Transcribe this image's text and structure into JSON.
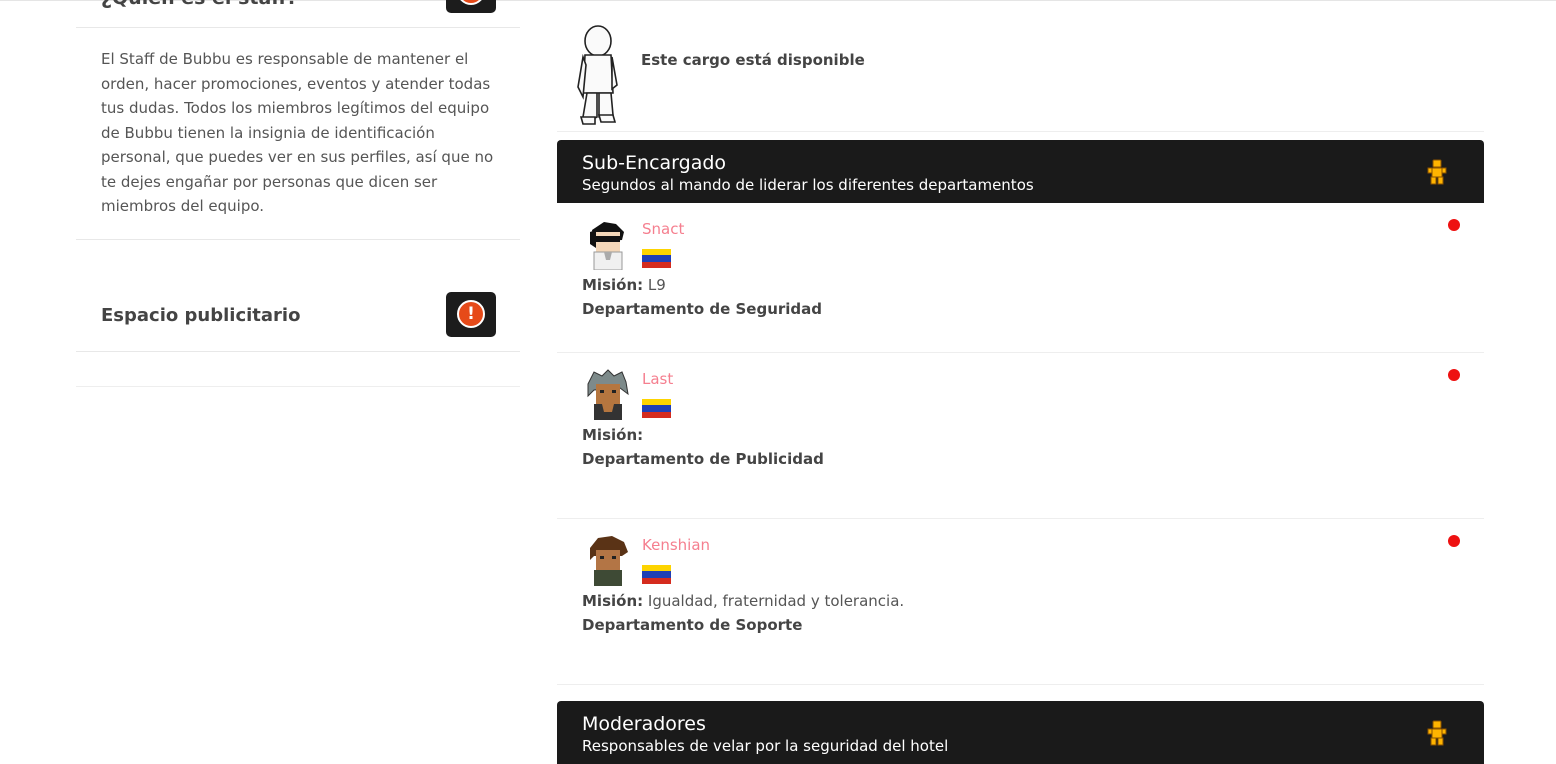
{
  "sidebar": {
    "staff_title": "¿Quién es el staff?",
    "staff_description": "El Staff de Bubbu es responsable de mantener el orden, hacer promociones, eventos y atender todas tus dudas. Todos los miembros legítimos del equipo de Bubbu tienen la insignia de identificación personal, que puedes ver en sus perfiles, así que no te dejes engañar por personas que dicen ser miembros del equipo.",
    "ad_title": "Espacio publicitario",
    "alert_icon": "exclamation-icon",
    "alert_glyph": "!"
  },
  "main": {
    "available_label": "Este cargo está disponible",
    "sections": [
      {
        "name": "Sub-Encargado",
        "subtitle": "Segundos al mando de liderar los diferentes departamentos",
        "members": [
          {
            "username": "Snact",
            "mission_label": "Misión:",
            "mission_value": "L9",
            "department": "Departamento de Seguridad",
            "status": "offline"
          },
          {
            "username": "Last",
            "mission_label": "Misión:",
            "mission_value": "",
            "department": "Departamento de Publicidad",
            "status": "offline"
          },
          {
            "username": "Kenshian",
            "mission_label": "Misión:",
            "mission_value": "Igualdad, fraternidad y tolerancia.",
            "department": "Departamento de Soporte",
            "status": "offline"
          }
        ]
      },
      {
        "name": "Moderadores",
        "subtitle": "Responsables de velar por la seguridad del hotel"
      }
    ]
  },
  "colors": {
    "username": "#f57f8f",
    "header_bg": "#1a1a1a",
    "status_offline": "#ee1111",
    "alert_badge": "#e64a19"
  }
}
